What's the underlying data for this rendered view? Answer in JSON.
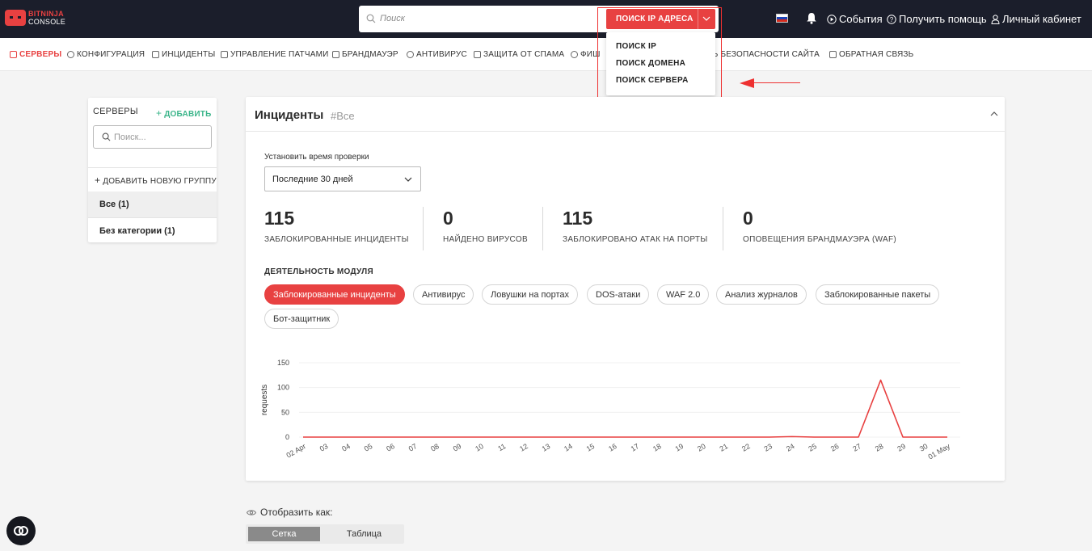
{
  "brand": {
    "line1": "BITNINJA",
    "line2": "CONSOLE"
  },
  "top_search": {
    "placeholder": "Поиск",
    "mode_button": "ПОИСК IP АДРЕСА"
  },
  "dropdown": {
    "items": [
      "ПОИСК IP",
      "ПОИСК ДОМЕНА",
      "ПОИСК СЕРВЕРА"
    ]
  },
  "top_links": {
    "events": "События",
    "help": "Получить помощь",
    "account": "Личный кабинет"
  },
  "nav": {
    "items": [
      "СЕРВЕРЫ",
      "КОНФИГУРАЦИЯ",
      "ИНЦИДЕНТЫ",
      "УПРАВЛЕНИЕ ПАТЧАМИ",
      "БРАНДМАУЭР",
      "АНТИВИРУС",
      "ЗАЩИТА ОТ СПАМА",
      "ФИШ",
      "ЛЬ БЕЗОПАСНОСТИ САЙТА",
      "ОБРАТНАЯ СВЯЗЬ"
    ]
  },
  "sidebar": {
    "title": "СЕРВЕРЫ",
    "add": "ДОБАВИТЬ",
    "search_placeholder": "Поиск...",
    "add_group": "ДОБАВИТЬ НОВУЮ ГРУППУ",
    "groups": [
      "Все (1)",
      "Без категории (1)"
    ]
  },
  "card": {
    "title": "Инциденты",
    "tag": "#Все",
    "time_label": "Установить время проверки",
    "time_value": "Последние 30 дней",
    "stats": [
      {
        "value": "115",
        "label": "ЗАБЛОКИРОВАННЫЕ ИНЦИДЕНТЫ"
      },
      {
        "value": "0",
        "label": "НАЙДЕНО ВИРУСОВ"
      },
      {
        "value": "115",
        "label": "ЗАБЛОКИРОВАНО АТАК НА ПОРТЫ"
      },
      {
        "value": "0",
        "label": "ОПОВЕЩЕНИЯ БРАНДМАУЭРА (WAF)"
      }
    ],
    "module_title": "ДЕЯТЕЛЬНОСТЬ МОДУЛЯ",
    "module_tabs": [
      "Заблокированные инциденты",
      "Антивирус",
      "Ловушки на портах",
      "DOS-атаки",
      "WAF 2.0",
      "Анализ журналов",
      "Заблокированные пакеты",
      "Бот-защитник"
    ]
  },
  "chart_data": {
    "type": "line",
    "ylabel": "requests",
    "ylim": [
      0,
      150
    ],
    "yticks": [
      0,
      50,
      100,
      150
    ],
    "categories": [
      "02 Apr",
      "03",
      "04",
      "05",
      "06",
      "07",
      "08",
      "09",
      "10",
      "11",
      "12",
      "13",
      "14",
      "15",
      "16",
      "17",
      "18",
      "19",
      "20",
      "21",
      "22",
      "23",
      "24",
      "25",
      "26",
      "27",
      "28",
      "29",
      "30",
      "01 May"
    ],
    "series": [
      {
        "values": [
          0,
          0,
          0,
          0,
          0,
          0,
          0,
          0,
          0,
          0,
          0,
          0,
          0,
          0,
          0,
          0,
          0,
          0,
          0,
          0,
          0,
          0,
          1,
          0,
          0,
          0,
          115,
          0,
          0,
          0
        ],
        "color": "#e84141"
      }
    ]
  },
  "display": {
    "label": "Отобразить как:",
    "grid": "Сетка",
    "table": "Таблица"
  },
  "colors": {
    "accent": "#e84141",
    "topbar": "#1b1e2b",
    "green": "#3bb58a"
  }
}
